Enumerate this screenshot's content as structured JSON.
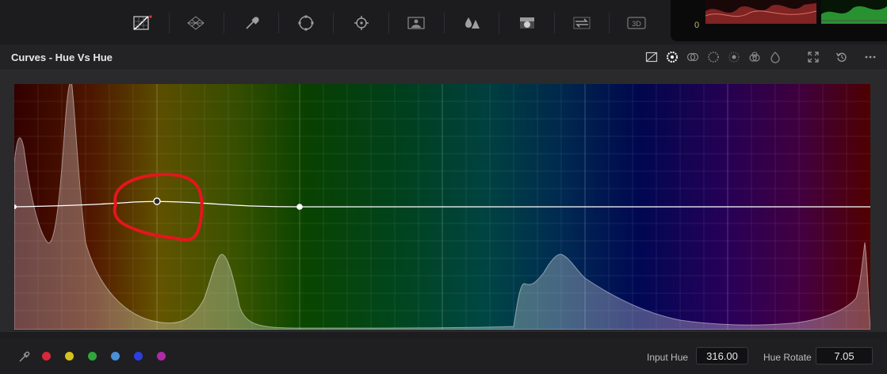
{
  "scope": {
    "zero_label": "0"
  },
  "toolbar": {
    "tools": [
      {
        "name": "curves-tool-icon"
      },
      {
        "name": "color-warper-icon"
      },
      {
        "name": "qualifier-eyedropper-icon"
      },
      {
        "name": "power-window-icon"
      },
      {
        "name": "tracker-icon"
      },
      {
        "name": "magic-mask-icon"
      },
      {
        "name": "blur-icon"
      },
      {
        "name": "key-icon"
      },
      {
        "name": "sizing-icon"
      },
      {
        "name": "3d-icon",
        "label": "3D"
      }
    ]
  },
  "header": {
    "title": "Curves - Hue Vs Hue",
    "icons": [
      "custom-curve-icon",
      "hue-vs-hue-icon",
      "hue-vs-sat-icon",
      "hue-vs-lum-icon",
      "lum-vs-sat-icon",
      "sat-vs-sat-icon",
      "sat-vs-lum-icon",
      "expand-icon",
      "reset-icon",
      "more-options-icon"
    ]
  },
  "footer": {
    "swatches": [
      {
        "name": "red-swatch",
        "color": "#d8283a"
      },
      {
        "name": "yellow-swatch",
        "color": "#d6c21c"
      },
      {
        "name": "green-swatch",
        "color": "#2fa83a"
      },
      {
        "name": "cyan-swatch",
        "color": "#4a8fd8"
      },
      {
        "name": "blue-swatch",
        "color": "#2b3fe0"
      },
      {
        "name": "magenta-swatch",
        "color": "#b02aa8"
      }
    ],
    "input_hue_label": "Input Hue",
    "input_hue_value": "316.00",
    "hue_rotate_label": "Hue Rotate",
    "hue_rotate_value": "7.05"
  }
}
